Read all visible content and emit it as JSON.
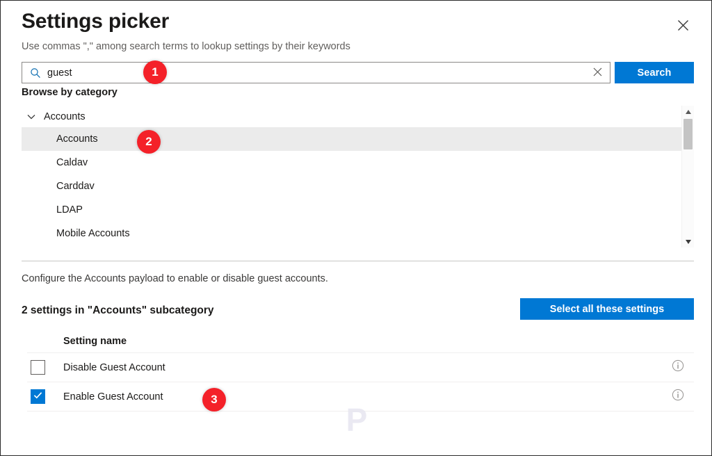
{
  "dialog": {
    "title": "Settings picker",
    "subtitle": "Use commas \",\" among search terms to lookup settings by their keywords",
    "close_label": "close-icon"
  },
  "search": {
    "value": "guest",
    "placeholder": "Search",
    "icon": "search-icon",
    "clear_icon": "clear-icon",
    "submit_label": "Search"
  },
  "browse": {
    "label": "Browse by category",
    "group": {
      "label": "Accounts",
      "expanded": true,
      "chevron_icon": "chevron-down-icon"
    },
    "items": [
      {
        "label": "Accounts",
        "selected": true
      },
      {
        "label": "Caldav",
        "selected": false
      },
      {
        "label": "Carddav",
        "selected": false
      },
      {
        "label": "LDAP",
        "selected": false
      },
      {
        "label": "Mobile Accounts",
        "selected": false
      }
    ],
    "scrollbar": {
      "up_icon": "scroll-up-arrow-icon",
      "down_icon": "scroll-down-arrow-icon"
    }
  },
  "details": {
    "description": "Configure the Accounts payload to enable or disable guest accounts.",
    "count_label": "2 settings in \"Accounts\" subcategory",
    "select_all_label": "Select all these settings"
  },
  "table": {
    "columns": [
      "Setting name"
    ],
    "rows": [
      {
        "name": "Disable Guest Account",
        "checked": false,
        "info_icon": "info-icon"
      },
      {
        "name": "Enable Guest Account",
        "checked": true,
        "info_icon": "info-icon"
      }
    ]
  },
  "callouts": [
    {
      "number": "1"
    },
    {
      "number": "2"
    },
    {
      "number": "3"
    }
  ],
  "watermark": {
    "text": "P"
  },
  "colors": {
    "accent": "#0078d4",
    "callout": "#f42129",
    "selected_row": "#ebebeb",
    "border": "#8a8886"
  }
}
